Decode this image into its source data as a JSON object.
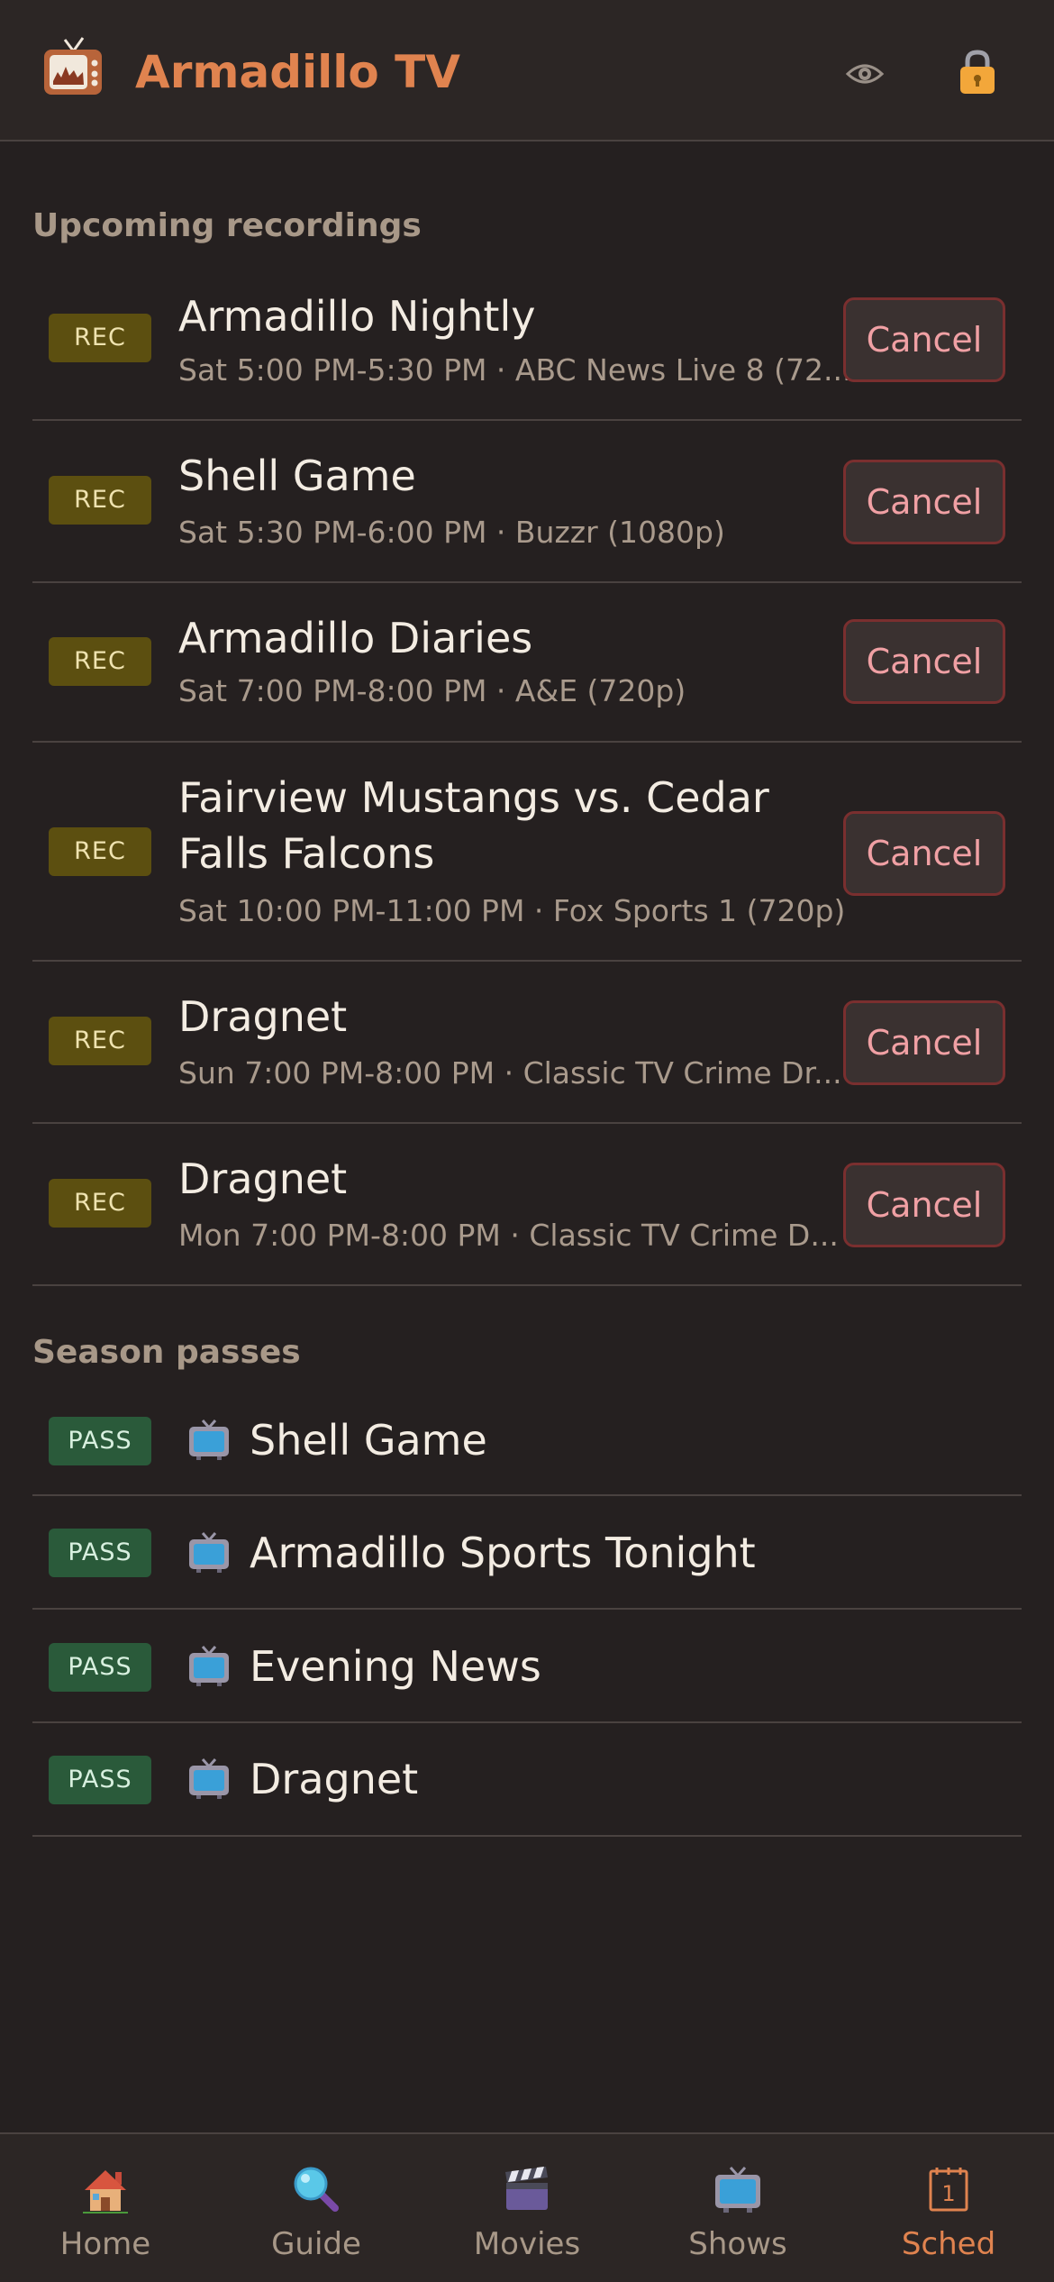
{
  "header": {
    "title": "Armadillo TV",
    "icons": [
      "tv-logo-icon",
      "eye-icon",
      "lock-icon"
    ]
  },
  "upcoming": {
    "title": "Upcoming recordings",
    "items": [
      {
        "badge": "REC",
        "title": "Armadillo Nightly",
        "subtitle": "Sat 5:00 PM-5:30 PM · ABC News Live 8 (72...",
        "action": "Cancel"
      },
      {
        "badge": "REC",
        "title": "Shell Game",
        "subtitle": "Sat 5:30 PM-6:00 PM · Buzzr (1080p)",
        "action": "Cancel"
      },
      {
        "badge": "REC",
        "title": "Armadillo Diaries",
        "subtitle": "Sat 7:00 PM-8:00 PM · A&E (720p)",
        "action": "Cancel"
      },
      {
        "badge": "REC",
        "title": "Fairview Mustangs vs. Cedar Falls Falcons",
        "subtitle": "Sat 10:00 PM-11:00 PM · Fox Sports 1 (720p)",
        "action": "Cancel"
      },
      {
        "badge": "REC",
        "title": "Dragnet",
        "subtitle": "Sun 7:00 PM-8:00 PM · Classic TV Crime Dr...",
        "action": "Cancel"
      },
      {
        "badge": "REC",
        "title": "Dragnet",
        "subtitle": "Mon 7:00 PM-8:00 PM · Classic TV Crime D...",
        "action": "Cancel"
      }
    ]
  },
  "season_passes": {
    "title": "Season passes",
    "items": [
      {
        "badge": "PASS",
        "title": "Shell Game"
      },
      {
        "badge": "PASS",
        "title": "Armadillo Sports Tonight"
      },
      {
        "badge": "PASS",
        "title": "Evening News"
      },
      {
        "badge": "PASS",
        "title": "Dragnet"
      }
    ]
  },
  "nav": {
    "active": "Sched",
    "items": [
      {
        "label": "Home",
        "icon": "house-icon"
      },
      {
        "label": "Guide",
        "icon": "magnifier-icon"
      },
      {
        "label": "Movies",
        "icon": "clapperboard-icon"
      },
      {
        "label": "Shows",
        "icon": "tv-icon"
      },
      {
        "label": "Sched",
        "icon": "calendar-icon"
      }
    ]
  },
  "colors": {
    "background": "#252020",
    "accent": "#e0834f",
    "rec_badge": "#5c4f10",
    "pass_badge": "#2a5a3a",
    "cancel_text": "#f0a0a4"
  }
}
